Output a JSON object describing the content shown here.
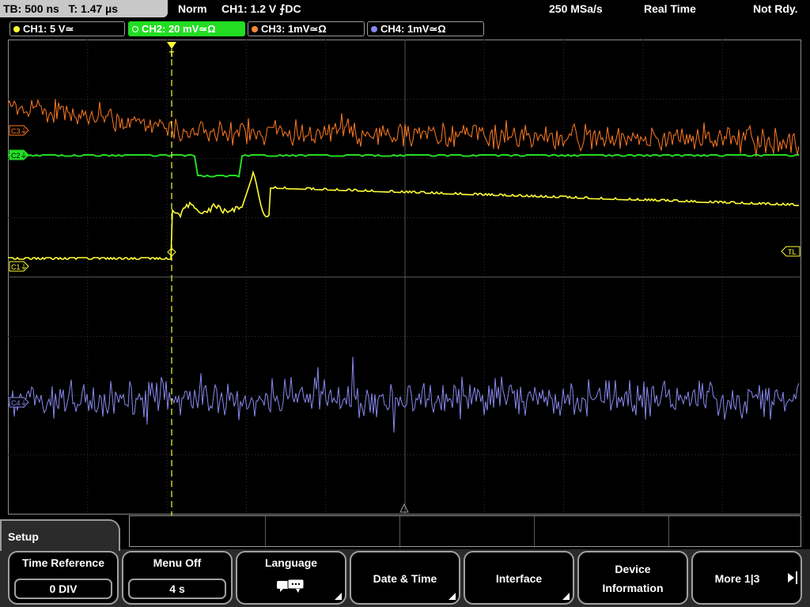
{
  "status": {
    "timebase": "TB: 500 ns",
    "trigger_time": "T: 1.47 µs",
    "mode": "Norm",
    "trigger_setting": "CH1: 1.2 V ⨍DC",
    "sample_rate": "250 MSa/s",
    "acq_mode": "Real Time",
    "state": "Not Rdy."
  },
  "channels": [
    {
      "label": "CH1: 5 V≃",
      "color": "#ffff33",
      "active": false
    },
    {
      "label": "CH2: 20 mV≃Ω",
      "color": "#22dd22",
      "active": true
    },
    {
      "label": "CH3: 1mV≃Ω",
      "color": "#ff8833",
      "active": false
    },
    {
      "label": "CH4: 1mV≃Ω",
      "color": "#8888ee",
      "active": false
    }
  ],
  "markers": {
    "c3": "C3⏚",
    "c2": "C2⏚",
    "c1": "C1⏚",
    "c4": "C4⏚",
    "tl": "TL",
    "trigger": "T"
  },
  "menu": {
    "title": "Setup",
    "keys": [
      {
        "label": "Time Reference",
        "value": "0 DIV"
      },
      {
        "label": "Menu Off",
        "value": "4 s"
      },
      {
        "label": "Language",
        "icon": "speech-bubbles-icon"
      },
      {
        "label": "Date & Time"
      },
      {
        "label": "Interface"
      },
      {
        "label_line1": "Device",
        "label_line2": "Information"
      },
      {
        "label": "More 1|3"
      }
    ]
  }
}
